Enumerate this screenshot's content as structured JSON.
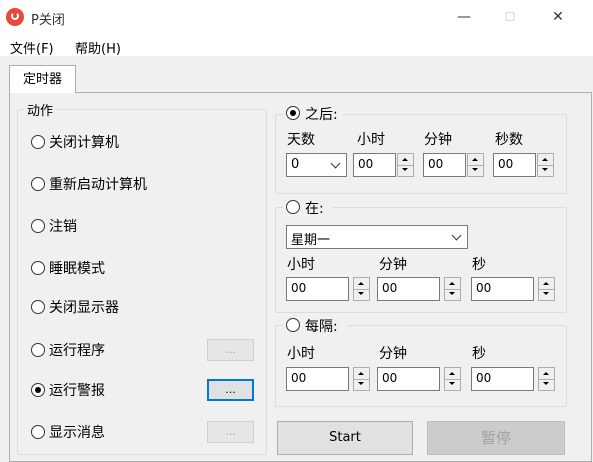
{
  "window": {
    "title": "P关闭",
    "minimize": "—",
    "maximize": "☐",
    "close": "✕"
  },
  "menu": {
    "file": "文件(F)",
    "help": "帮助(H)"
  },
  "tab": {
    "label": "定时器"
  },
  "actions": {
    "group_label": "动作",
    "selected": "运行警报",
    "items": [
      {
        "label": "关闭计算机",
        "has_button": false
      },
      {
        "label": "重新启动计算机",
        "has_button": false
      },
      {
        "label": "注销",
        "has_button": false
      },
      {
        "label": "睡眠模式",
        "has_button": false
      },
      {
        "label": "关闭显示器",
        "has_button": false
      },
      {
        "label": "运行程序",
        "has_button": true,
        "button_label": "...",
        "button_enabled": false
      },
      {
        "label": "运行警报",
        "has_button": true,
        "button_label": "...",
        "button_enabled": true
      },
      {
        "label": "显示消息",
        "has_button": true,
        "button_label": "...",
        "button_enabled": false
      }
    ]
  },
  "after": {
    "label": "之后:",
    "selected": true,
    "days_label": "天数",
    "hours_label": "小时",
    "minutes_label": "分钟",
    "seconds_label": "秒数",
    "days_value": "0",
    "hours_value": "00",
    "minutes_value": "00",
    "seconds_value": "00"
  },
  "at": {
    "label": "在:",
    "selected": false,
    "day_value": "星期一",
    "hours_label": "小时",
    "minutes_label": "分钟",
    "seconds_label": "秒",
    "hours_value": "00",
    "minutes_value": "00",
    "seconds_value": "00"
  },
  "every": {
    "label": "每隔:",
    "selected": false,
    "hours_label": "小时",
    "minutes_label": "分钟",
    "seconds_label": "秒",
    "hours_value": "00",
    "minutes_value": "00",
    "seconds_value": "00"
  },
  "buttons": {
    "start": "Start",
    "pause": "暂停"
  }
}
